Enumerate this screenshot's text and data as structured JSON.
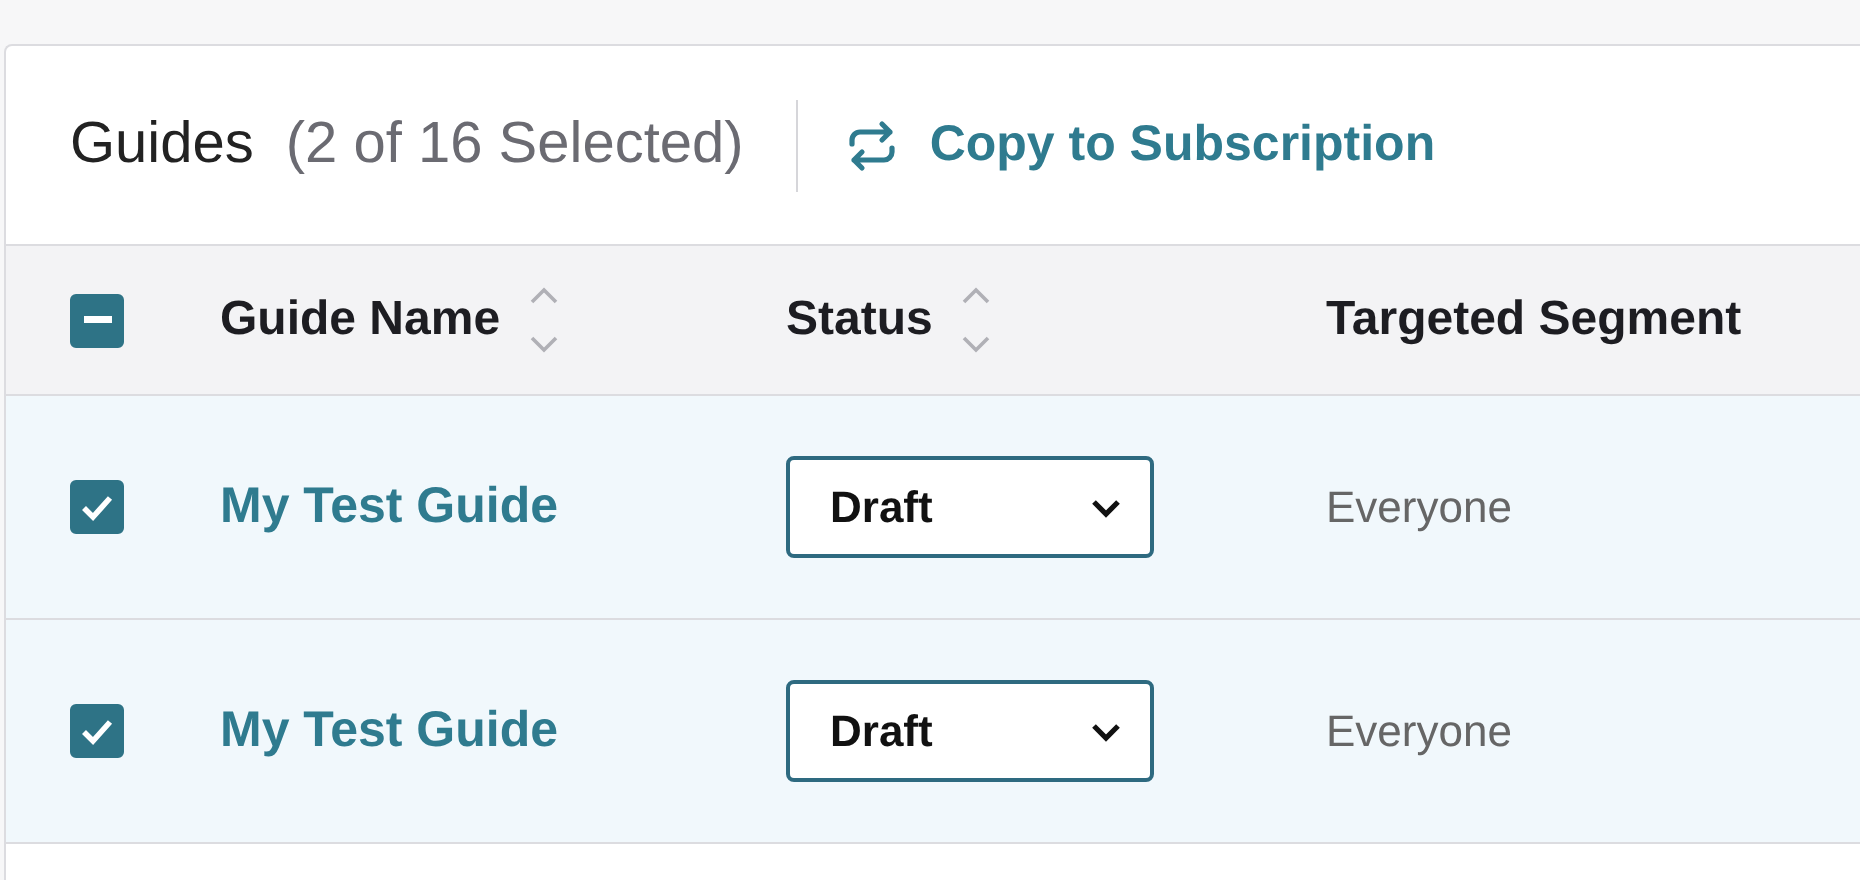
{
  "header": {
    "title": "Guides",
    "selection_count": "(2 of 16 Selected)",
    "action": "Copy to Subscription"
  },
  "table": {
    "select_all": {
      "indeterminate": true
    },
    "columns": [
      {
        "label": "Guide Name",
        "sortable": true
      },
      {
        "label": "Status",
        "sortable": true
      },
      {
        "label": "Targeted Segment",
        "sortable": false
      }
    ],
    "rows": [
      {
        "checked": true,
        "name": "My Test Guide",
        "status": "Draft",
        "segment": "Everyone"
      },
      {
        "checked": true,
        "name": "My Test Guide",
        "status": "Draft",
        "segment": "Everyone"
      }
    ]
  }
}
